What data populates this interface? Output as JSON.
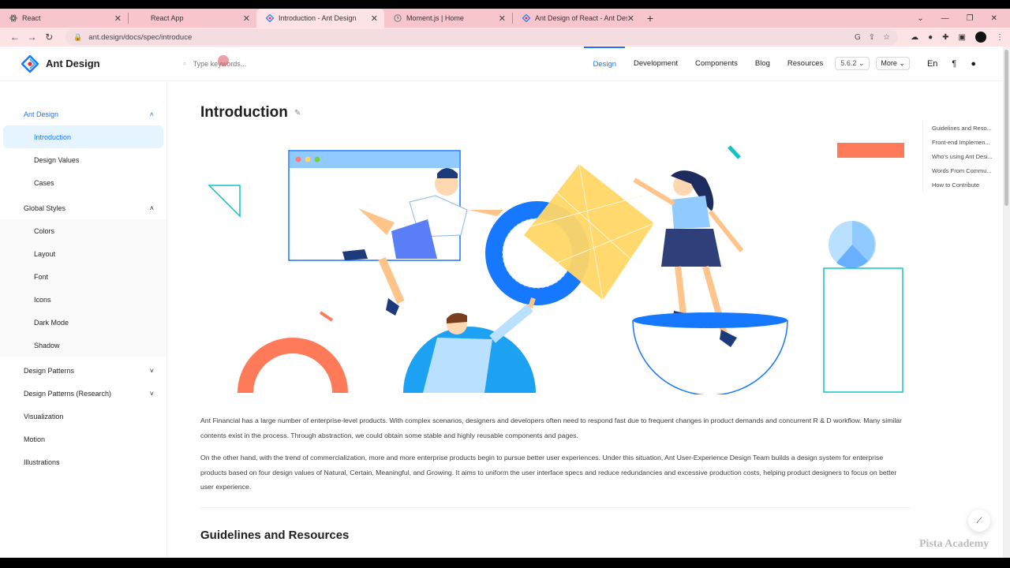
{
  "browser": {
    "tabs": [
      {
        "label": "React",
        "icon": "react-icon"
      },
      {
        "label": "React App",
        "icon": "react-icon"
      },
      {
        "label": "Introduction - Ant Design",
        "icon": "antd-icon",
        "active": true
      },
      {
        "label": "Moment.js | Home",
        "icon": "moment-icon"
      },
      {
        "label": "Ant Design of React - Ant Design",
        "icon": "antd-icon"
      }
    ],
    "url": "ant.design/docs/spec/introduce"
  },
  "header": {
    "logo_text": "Ant Design",
    "search_placeholder": "Type keywords...",
    "menu": [
      "Design",
      "Development",
      "Components",
      "Blog",
      "Resources"
    ],
    "version": "5.6.2",
    "more_label": "More",
    "accent": "#1677ff"
  },
  "sidebar": {
    "groups": [
      {
        "label": "Ant Design",
        "items": [
          "Introduction",
          "Design Values",
          "Cases"
        ]
      },
      {
        "label": "Global Styles",
        "items": [
          "Colors",
          "Layout",
          "Font",
          "Icons",
          "Dark Mode",
          "Shadow"
        ]
      },
      {
        "label": "Design Patterns"
      },
      {
        "label": "Design Patterns (Research)"
      },
      {
        "label": "Visualization"
      },
      {
        "label": "Motion"
      },
      {
        "label": "Illustrations"
      }
    ]
  },
  "main": {
    "title": "Introduction",
    "para1": "Ant Financial has a large number of enterprise-level products. With complex scenarios, designers and developers often need to respond fast due to frequent changes in product demands and concurrent R & D workflow. Many similar contents exist in the process. Through abstraction, we could obtain some stable and highly reusable components and pages.",
    "para2": "On the other hand, with the trend of commercialization, more and more enterprise products begin to pursue better user experiences. Under this situation, Ant User-Experience Design Team builds a design system for enterprise products based on four design values of Natural, Certain, Meaningful, and Growing. It aims to uniform the user interface specs and reduce redundancies and excessive production costs, helping product designers to focus on better user experience.",
    "section_title": "Guidelines and Resources"
  },
  "toc": [
    "Guidelines and Reso...",
    "Front-end Implemen...",
    "Who's using Ant Desi...",
    "Words From Commu...",
    "How to Contribute"
  ],
  "watermark": "Pista Academy"
}
